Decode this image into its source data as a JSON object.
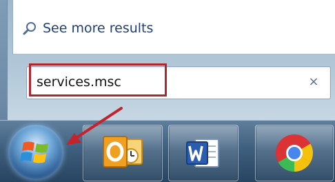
{
  "start_menu": {
    "see_more_label": "See more results",
    "search": {
      "value": "services.msc",
      "clear_icon": "×"
    }
  },
  "taskbar": {
    "items": [
      {
        "name": "start-orb",
        "icon": "windows-logo-icon"
      },
      {
        "name": "outlook",
        "icon": "outlook-icon"
      },
      {
        "name": "word",
        "icon": "word-icon"
      },
      {
        "name": "chrome",
        "icon": "chrome-icon"
      }
    ]
  },
  "annotations": {
    "highlight_color": "#b0262d"
  }
}
